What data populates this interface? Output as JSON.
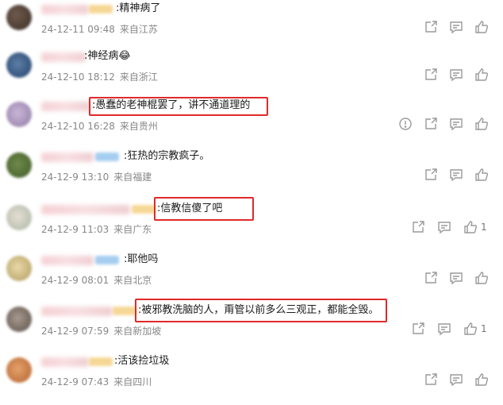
{
  "comments": [
    {
      "text": ":精神病了",
      "date": "24-12-11 09:48",
      "location": "来自江苏"
    },
    {
      "text": ":神经病😂",
      "date": "24-12-10 18:12",
      "location": "来自浙江"
    },
    {
      "text": ":愚蠢的老神棍罢了，讲不通道理的",
      "date": "24-12-10 16:28",
      "location": "来自贵州"
    },
    {
      "text": ":狂热的宗教疯子。",
      "date": "24-12-9 13:10",
      "location": "来自福建"
    },
    {
      "text": ":信教信傻了吧",
      "date": "24-12-9 11:03",
      "location": "来自广东",
      "likes": "1"
    },
    {
      "text": ":耶他吗",
      "date": "24-12-9 08:01",
      "location": "来自北京"
    },
    {
      "text": ":被邪教洗脑的人，甭管以前多么三观正，都能全毁。",
      "date": "24-12-9 07:59",
      "location": "来自新加坡",
      "likes": "1"
    },
    {
      "text": ":活该捡垃圾",
      "date": "24-12-9 07:43",
      "location": "来自四川"
    }
  ],
  "icons": {
    "share": "share-icon",
    "comment": "comment-icon",
    "like": "thumbs-up-icon",
    "report": "report-icon"
  },
  "colors": {
    "highlight": "#e02a2a",
    "meta_text": "#888888",
    "icon": "#9a9a9a"
  }
}
